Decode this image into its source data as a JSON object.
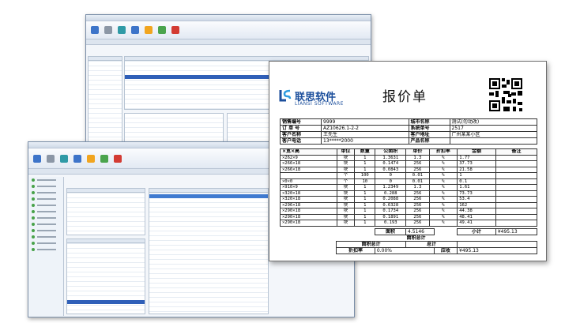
{
  "quote": {
    "brand_cn": "联思软件",
    "brand_en": "LIANSI SOFTWARE",
    "title": "报价单",
    "info": [
      {
        "k1": "销售编号",
        "v1": "9999",
        "k2": "城市名称",
        "v2": "测试(勿动改)"
      },
      {
        "k1": "订 单 号",
        "v1": "AZ10626.1-2-2",
        "k2": "系统单号",
        "v2": "2517"
      },
      {
        "k1": "客户名称",
        "v1": "王先生",
        "k2": "客户地址",
        "v2": "广州某某小区"
      },
      {
        "k1": "客户电话",
        "v1": "13*****2000",
        "k2": "产品名称",
        "v2": ""
      }
    ],
    "headers": [
      "×宽×高",
      "单位",
      "数量",
      "公面积",
      "单价",
      "折扣率",
      "金额",
      "备注"
    ],
    "rows": [
      {
        "spec": "×262×9",
        "unit": "块",
        "qty": "1",
        "area": "1.3631",
        "price": "1.3",
        "discount": "%",
        "amount": "1.77",
        "note": ""
      },
      {
        "spec": "×266×18",
        "unit": "块",
        "qty": "1",
        "area": "0.1474",
        "price": "256",
        "discount": "%",
        "amount": "37.73",
        "note": ""
      },
      {
        "spec": "×266×18",
        "unit": "块",
        "qty": "1",
        "area": "0.0843",
        "price": "256",
        "discount": "%",
        "amount": "21.58",
        "note": ""
      },
      {
        "spec": "",
        "unit": "个",
        "qty": "100",
        "area": "0",
        "price": "0.01",
        "discount": "%",
        "amount": "1",
        "note": ""
      },
      {
        "spec": "×0×0",
        "unit": "个",
        "qty": "10",
        "area": "0",
        "price": "0.01",
        "discount": "%",
        "amount": "0.1",
        "note": ""
      },
      {
        "spec": "×910×9",
        "unit": "块",
        "qty": "1",
        "area": "1.2349",
        "price": "1.3",
        "discount": "%",
        "amount": "1.61",
        "note": ""
      },
      {
        "spec": "×320×18",
        "unit": "块",
        "qty": "1",
        "area": "0.288",
        "price": "256",
        "discount": "%",
        "amount": "73.73",
        "note": ""
      },
      {
        "spec": "×320×18",
        "unit": "块",
        "qty": "1",
        "area": "0.2088",
        "price": "256",
        "discount": "%",
        "amount": "53.4",
        "note": ""
      },
      {
        "spec": "×296×18",
        "unit": "块",
        "qty": "1",
        "area": "0.6328",
        "price": "256",
        "discount": "%",
        "amount": "162",
        "note": ""
      },
      {
        "spec": "×290×18",
        "unit": "块",
        "qty": "1",
        "area": "0.1734",
        "price": "256",
        "discount": "%",
        "amount": "44.38",
        "note": ""
      },
      {
        "spec": "×290×18",
        "unit": "块",
        "qty": "1",
        "area": "0.1891",
        "price": "256",
        "discount": "%",
        "amount": "48.41",
        "note": ""
      },
      {
        "spec": "×290×18",
        "unit": "块",
        "qty": "1",
        "area": "0.193",
        "price": "256",
        "discount": "%",
        "amount": "49.41",
        "note": ""
      }
    ],
    "subtotal": {
      "area_label": "面积",
      "area_value": "4.5146",
      "label": "小计",
      "value": "¥495.13"
    },
    "section_total_title": "面积总计",
    "totals": {
      "label1": "面积总计",
      "label2": "总计",
      "discount_label": "折扣率",
      "discount_value": "0.00%",
      "payable_label": "应收",
      "payable_value": "¥495.13"
    }
  },
  "colors": {
    "brand": "#1c4f9c",
    "window_border": "#7a8ea8",
    "selection": "#2f5fb8"
  }
}
